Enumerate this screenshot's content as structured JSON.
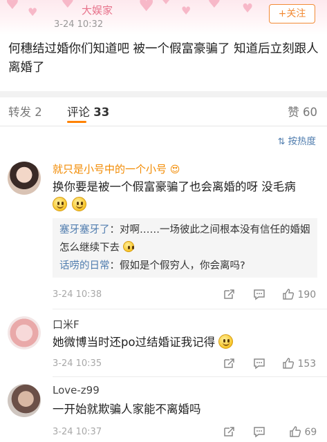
{
  "post": {
    "author": "大娱家",
    "time": "3-24 10:32",
    "follow_label": "+关注",
    "text": "何穗结过婚你们知道吧 被一个假富豪骗了 知道后立刻跟人离婚了"
  },
  "tabs": {
    "repost": "转发 2",
    "comment_label": "评论",
    "comment_count": "33",
    "like": "赞 60"
  },
  "sort_label": "按热度",
  "comments": [
    {
      "name": "就只是小号中的一个小号",
      "name_emoji": "😍",
      "text": "换你要是被一个假富豪骗了也会离婚的呀 没毛病",
      "replies": [
        {
          "name": "塞牙塞牙了",
          "text": "：对啊……一场彼此之间根本没有信任的婚姻 怎么继续下去"
        },
        {
          "name": "话唠的日常",
          "text": "：假如是个假穷人，你会离吗?"
        }
      ],
      "time": "3-24 10:38",
      "likes": "190"
    },
    {
      "name": "口米F",
      "text": "她微博当时还po过结婚证我记得",
      "time": "3-24 10:35",
      "likes": "153"
    },
    {
      "name": "Love-z99",
      "text": "一开始就欺骗人家能不离婚吗",
      "time": "3-24 10:37",
      "likes": "69"
    }
  ],
  "colors": {
    "accent": "#ff8200",
    "link": "#4f7cae",
    "vip_name": "#f28a00"
  }
}
